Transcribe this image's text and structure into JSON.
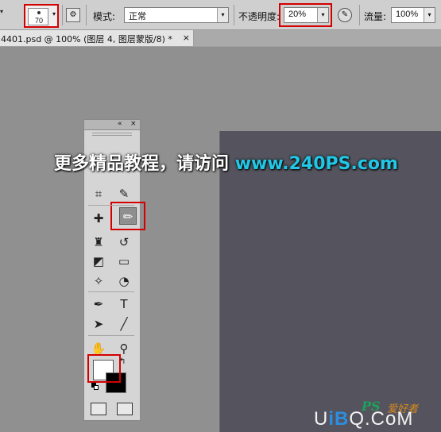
{
  "options_bar": {
    "brush_size": "70",
    "mode_label": "模式:",
    "mode_value": "正常",
    "opacity_label": "不透明度:",
    "opacity_value": "20%",
    "flow_label": "流量:",
    "flow_value": "100%"
  },
  "document_tab": {
    "title": "4401.psd @ 100% (图层 4, 图层蒙版/8) *",
    "close": "×"
  },
  "tool_panel": {
    "collapse": "«",
    "close": "×",
    "tools": [
      {
        "name": "crop-tool",
        "glyph": "⌗"
      },
      {
        "name": "eyedropper-tool",
        "glyph": "✎"
      },
      {
        "name": "healing-brush-tool",
        "glyph": "✚"
      },
      {
        "name": "brush-tool",
        "glyph": "✏"
      },
      {
        "name": "clone-stamp-tool",
        "glyph": "♜"
      },
      {
        "name": "history-brush-tool",
        "glyph": "↺"
      },
      {
        "name": "eraser-tool",
        "glyph": "◩"
      },
      {
        "name": "gradient-tool",
        "glyph": "▭"
      },
      {
        "name": "blur-tool",
        "glyph": "✧"
      },
      {
        "name": "dodge-tool",
        "glyph": "◔"
      },
      {
        "name": "pen-tool",
        "glyph": "✒"
      },
      {
        "name": "type-tool",
        "glyph": "T"
      },
      {
        "name": "path-selection-tool",
        "glyph": "➤"
      },
      {
        "name": "line-tool",
        "glyph": "╱"
      },
      {
        "name": "hand-tool",
        "glyph": "✋"
      },
      {
        "name": "zoom-tool",
        "glyph": "⚲"
      }
    ],
    "swap_glyph": "↰"
  },
  "colors": {
    "foreground": "#ffffff",
    "background": "#000000",
    "highlight": "#d40000",
    "canvas": "#55545e"
  },
  "watermark": {
    "chinese": "更多精品教程，请访问",
    "url": "www.240PS.com"
  },
  "logo": {
    "ps": "PS",
    "ps_suffix": "爱好者",
    "u": "U",
    "ib": "iB",
    "q": "Q",
    "com": ".CoM"
  }
}
